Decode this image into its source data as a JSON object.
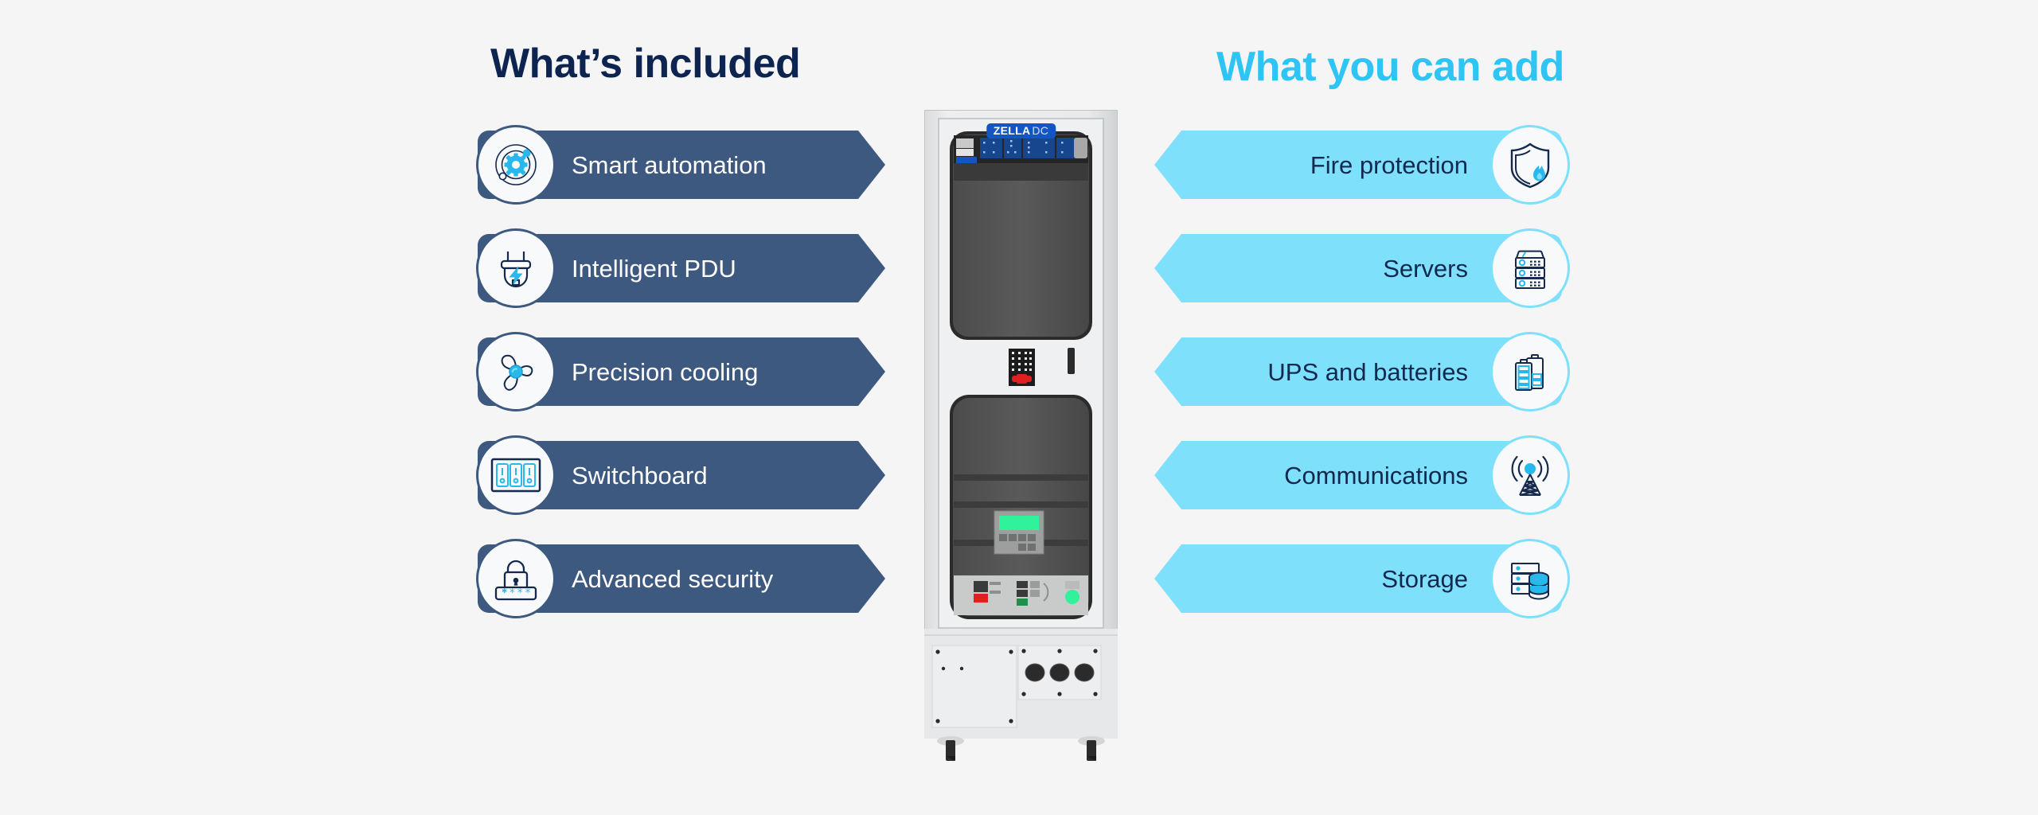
{
  "headings": {
    "left": "What’s included",
    "right": "What you can add"
  },
  "colors": {
    "background": "#f5f5f5",
    "included_pill": "#3d5980",
    "included_text": "#ffffff",
    "addon_pill": "#7fe0fb",
    "addon_text": "#11294f",
    "heading_left": "#0d2350",
    "heading_right": "#2ec4f3",
    "accent_cyan": "#29b8ec",
    "icon_outline": "#16294d"
  },
  "included": [
    {
      "label": "Smart automation",
      "icon": "smart-automation-icon"
    },
    {
      "label": "Intelligent PDU",
      "icon": "power-plug-icon"
    },
    {
      "label": "Precision cooling",
      "icon": "fan-icon"
    },
    {
      "label": "Switchboard",
      "icon": "switchboard-icon"
    },
    {
      "label": "Advanced security",
      "icon": "padlock-password-icon"
    }
  ],
  "addons": [
    {
      "label": "Fire protection",
      "icon": "shield-flame-icon"
    },
    {
      "label": "Servers",
      "icon": "server-rack-icon"
    },
    {
      "label": "UPS and batteries",
      "icon": "batteries-icon"
    },
    {
      "label": "Communications",
      "icon": "radio-tower-icon"
    },
    {
      "label": "Storage",
      "icon": "storage-database-icon"
    }
  ],
  "rack": {
    "brand": "ZELLA",
    "brand_suffix": "DC",
    "display_color": "#2ff29a",
    "indicator_color": "#2ff29a",
    "handle_color": "#e02020",
    "panel_color": "#17468e"
  }
}
